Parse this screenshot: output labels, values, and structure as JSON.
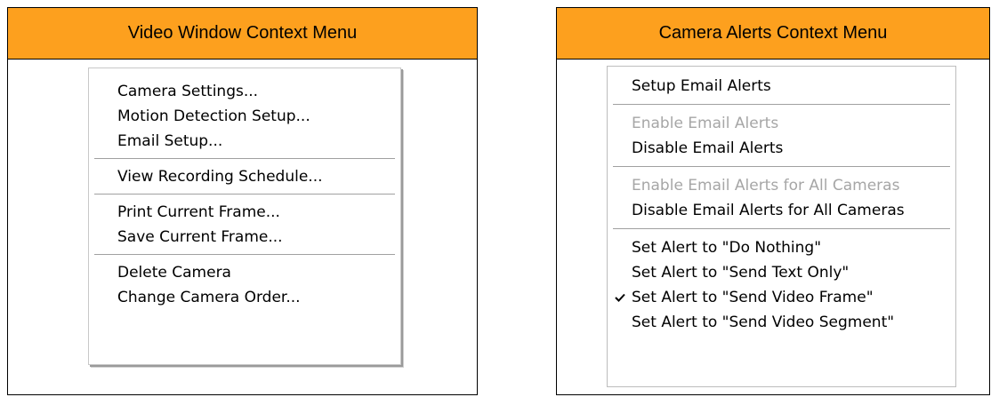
{
  "left_panel": {
    "title": "Video Window Context Menu",
    "items": [
      "Camera Settings...",
      "Motion Detection Setup...",
      "Email Setup...",
      "View Recording Schedule...",
      "Print Current Frame...",
      "Save Current Frame...",
      "Delete Camera",
      "Change Camera Order..."
    ]
  },
  "right_panel": {
    "title": "Camera Alerts Context Menu",
    "items": [
      "Setup Email Alerts",
      "Enable Email Alerts",
      "Disable Email Alerts",
      "Enable Email Alerts for All Cameras",
      "Disable Email Alerts for All Cameras",
      "Set Alert to \"Do Nothing\"",
      "Set Alert to \"Send Text Only\"",
      "Set Alert to \"Send Video Frame\"",
      "Set Alert to \"Send Video Segment\""
    ],
    "disabled_items": [
      "Enable Email Alerts",
      "Enable Email Alerts for All Cameras"
    ],
    "checked_item": "Set Alert to \"Send Video Frame\""
  },
  "colors": {
    "header_bg": "#FDA01E",
    "disabled_text": "#A6A6A6"
  },
  "icons": {
    "checkmark": "check-icon"
  }
}
